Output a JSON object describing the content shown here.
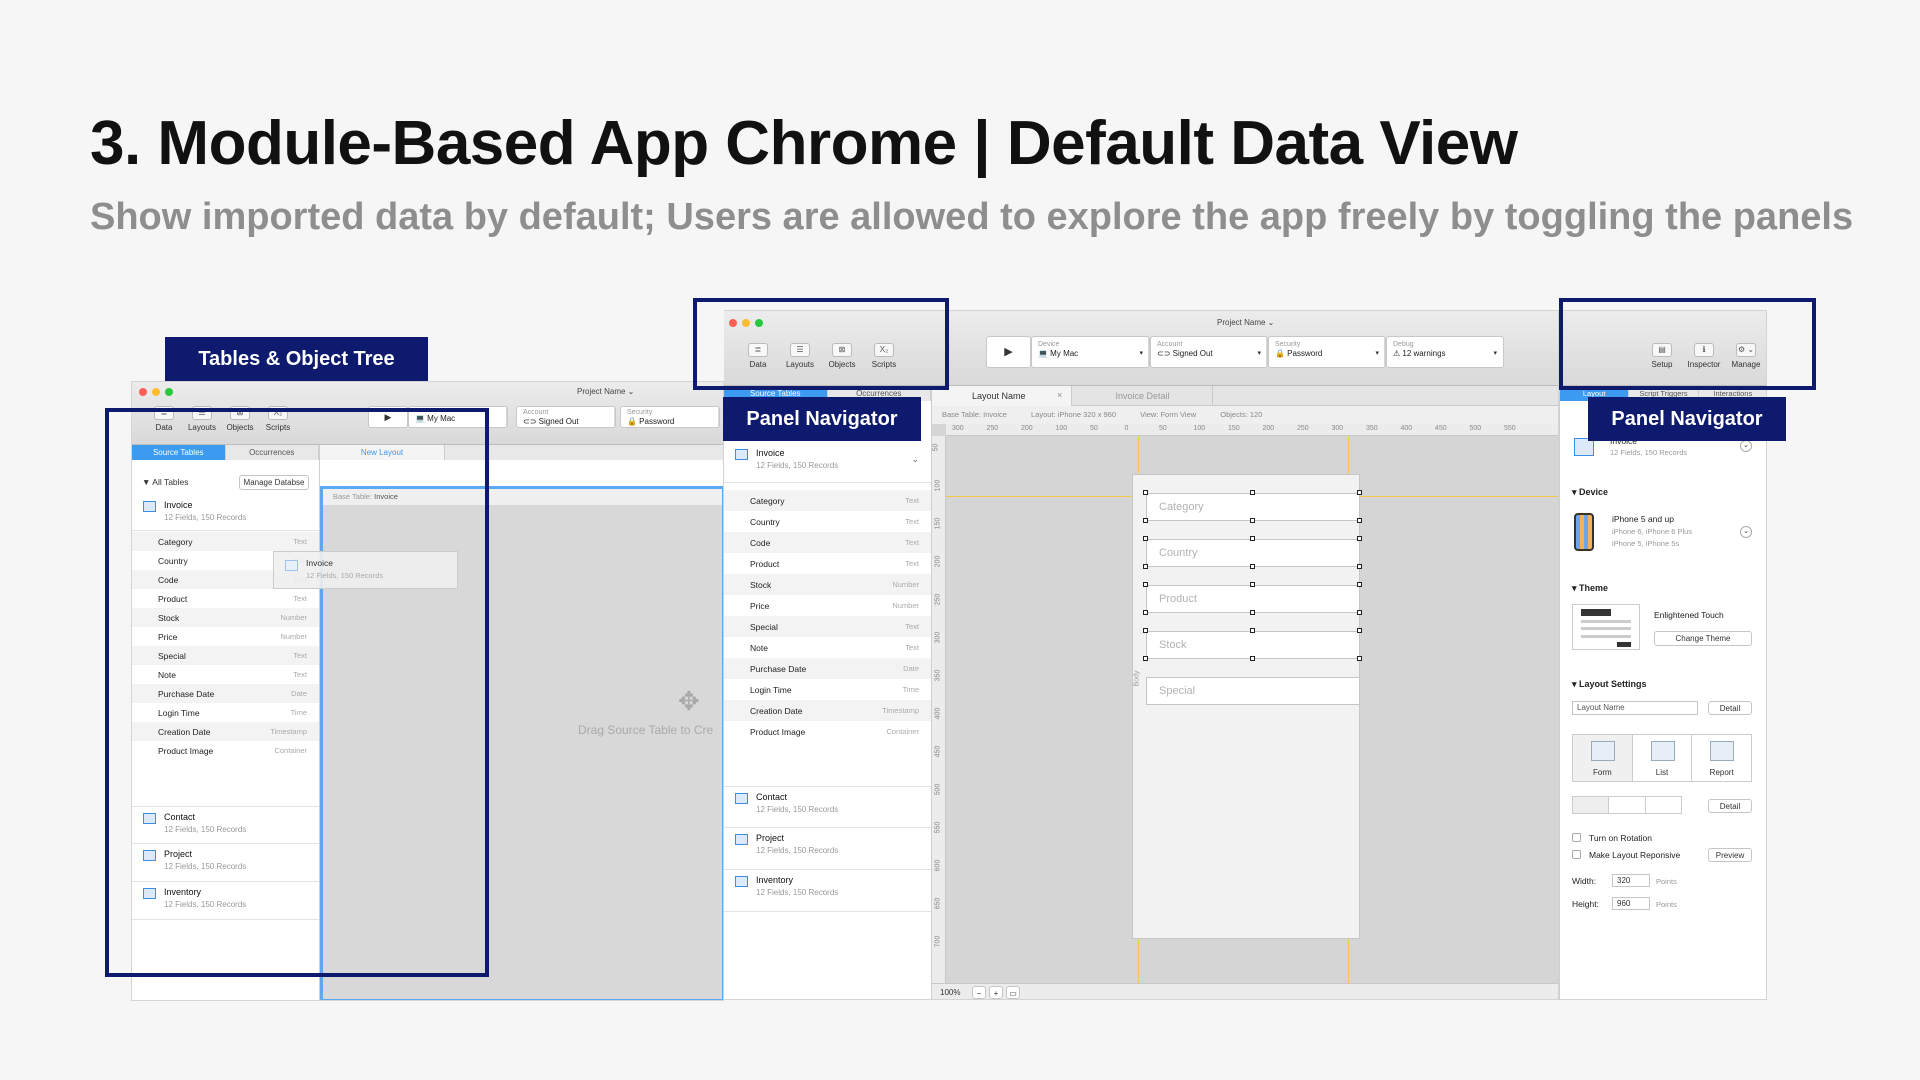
{
  "title": "3. Module-Based App Chrome | Default Data View",
  "subtitle": "Show imported data by default; Users are allowed to explore the app freely by toggling the panels",
  "callouts": {
    "tables_tree": "Tables & Object Tree",
    "panel_nav_left": "Panel Navigator",
    "panel_nav_right": "Panel Navigator"
  },
  "colors": {
    "accent": "#3c9af1",
    "callout": "#0e1a6e"
  },
  "app": {
    "project_name": "Project Name ⌄",
    "nav_buttons": [
      {
        "label": "Data",
        "icon": "database-icon",
        "glyph": "≣"
      },
      {
        "label": "Layouts",
        "icon": "layouts-icon",
        "glyph": "☰"
      },
      {
        "label": "Objects",
        "icon": "objects-icon",
        "glyph": "⊠"
      },
      {
        "label": "Scripts",
        "icon": "scripts-icon",
        "glyph": "X₂"
      }
    ],
    "run_glyph": "▶",
    "device": {
      "label": "Device",
      "value": "💻 My Mac"
    },
    "account": {
      "label": "Account",
      "value": "⊂⊃ Signed Out"
    },
    "security": {
      "label": "Security",
      "value": "🔒 Password"
    },
    "debug": {
      "label": "Debug",
      "value": "⚠ 12 warnings"
    },
    "right_buttons": [
      {
        "label": "Setup",
        "icon": "setup-icon",
        "glyph": "▤"
      },
      {
        "label": "Inspector",
        "icon": "inspector-icon",
        "glyph": "ℹ"
      },
      {
        "label": "Manage",
        "icon": "manage-gear-icon",
        "glyph": "⚙ ⌄"
      }
    ]
  },
  "left_window": {
    "tabs": [
      "Source Tables",
      "Occurrences"
    ],
    "new_layout_tab": "New Layout",
    "all_tables": "▼ All Tables",
    "manage_db": "Manage Databse",
    "base_table_label": "Base Table:",
    "base_table_value": "Invoice",
    "drag_hint": "Drag Source Table to Cre",
    "drag_ghost_name": "Invoice",
    "drag_ghost_sub": "12 Fields, 150 Records"
  },
  "tables": [
    {
      "name": "Invoice",
      "sub": "12 Fields, 150 Records"
    },
    {
      "name": "Contact",
      "sub": "12 Fields, 150 Records"
    },
    {
      "name": "Project",
      "sub": "12 Fields, 150 Records"
    },
    {
      "name": "Inventory",
      "sub": "12 Fields, 150 Records"
    }
  ],
  "fields_left": [
    {
      "name": "Category",
      "type": "Text"
    },
    {
      "name": "Country",
      "type": "Text"
    },
    {
      "name": "Code",
      "type": "Text"
    },
    {
      "name": "Product",
      "type": "Text"
    },
    {
      "name": "Stock",
      "type": "Number"
    },
    {
      "name": "Price",
      "type": "Number"
    },
    {
      "name": "Special",
      "type": "Text"
    },
    {
      "name": "Note",
      "type": "Text"
    },
    {
      "name": "Purchase Date",
      "type": "Date"
    },
    {
      "name": "Login Time",
      "type": "Time"
    },
    {
      "name": "Creation Date",
      "type": "Timestamp"
    },
    {
      "name": "Product Image",
      "type": "Container"
    }
  ],
  "fields_mid": [
    {
      "name": "Category",
      "type": "Text"
    },
    {
      "name": "Country",
      "type": "Text"
    },
    {
      "name": "Code",
      "type": "Text"
    },
    {
      "name": "Product",
      "type": "Text"
    },
    {
      "name": "Stock",
      "type": "Number"
    },
    {
      "name": "Price",
      "type": "Number"
    },
    {
      "name": "Special",
      "type": "Text"
    },
    {
      "name": "Note",
      "type": "Text"
    },
    {
      "name": "Purchase Date",
      "type": "Date"
    },
    {
      "name": "Login Time",
      "type": "Time"
    },
    {
      "name": "Creation Date",
      "type": "Timestamp"
    },
    {
      "name": "Product Image",
      "type": "Container"
    }
  ],
  "main_window": {
    "tabs": [
      "Source Tables",
      "Occurrences"
    ],
    "doc_tabs": [
      "Layout Name",
      "Invoice Detail"
    ],
    "close_glyph": "×",
    "info": {
      "base_table": "Base Table:  Invoice",
      "layout": "Layout:  iPhone  320 x 960",
      "view": "View:  Form View",
      "objects": "Objects:  120"
    },
    "ruler_h": [
      "300",
      "250",
      "200",
      "100",
      "50",
      "0",
      "50",
      "100",
      "150",
      "200",
      "250",
      "300",
      "350",
      "400",
      "450",
      "500",
      "550"
    ],
    "ruler_v": [
      "50",
      "100",
      "150",
      "200",
      "250",
      "300",
      "350",
      "400",
      "450",
      "500",
      "550",
      "600",
      "650",
      "700"
    ],
    "canvas_fields": [
      "Category",
      "Country",
      "Product",
      "Stock",
      "Special"
    ],
    "body_label": "Body",
    "zoom": "100%",
    "zoom_minus": "−",
    "zoom_plus": "+",
    "zoom_fit": "▭"
  },
  "inspector": {
    "tabs": [
      "Layout",
      "Script Triggers",
      "Interactions"
    ],
    "table_name": "Invoice",
    "table_sub": "12 Fields, 150 Records",
    "device_section": "Device",
    "device_name": "iPhone 5 and up",
    "device_sub1": "iPhone 6, iPhone 6 Plus",
    "device_sub2": "iPhone 5, iPhone 5s",
    "theme_section": "Theme",
    "theme_name": "Enlightened Touch",
    "change_theme": "Change Theme",
    "layout_settings": "Layout Settings",
    "layout_name_placeholder": "Layout Name",
    "detail": "Detail",
    "view_types": [
      "Form",
      "List",
      "Report"
    ],
    "detail2": "Detail",
    "rotation": "Turn on Rotation",
    "responsive": "Make Layout Reponsive",
    "preview": "Preview",
    "width_label": "Width:",
    "width_value": "320",
    "height_label": "Height:",
    "height_value": "960",
    "points": "Points"
  }
}
